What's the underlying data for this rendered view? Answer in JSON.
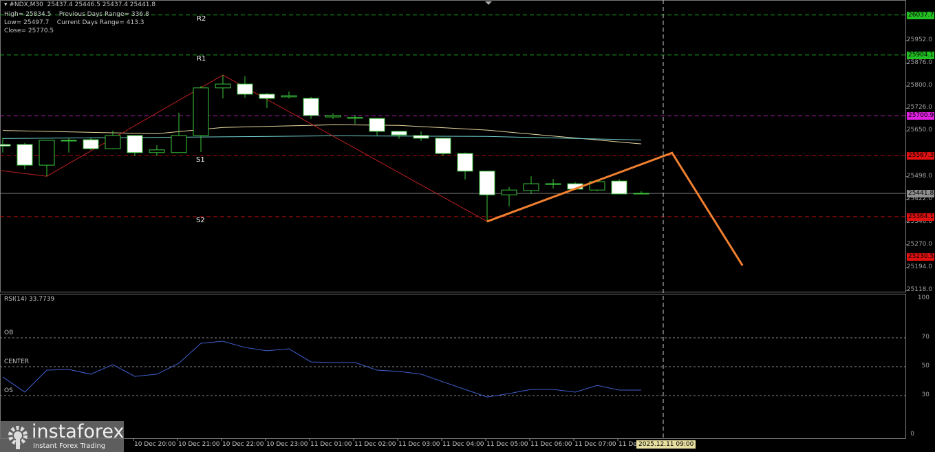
{
  "header": {
    "symbol_line": "#NDX,M30  25437.4 25446.5 25437.4 25441.8",
    "high": "High= 25834.5",
    "prev_range": "Previous Days Range= 336.8",
    "low": "Low= 25497.7",
    "cur_range": "Current Days Range= 413.3",
    "close": "Close= 25770.5"
  },
  "levels": [
    {
      "name": "R2",
      "price": 26037.7,
      "tag": "26037.7",
      "color": "#22c022"
    },
    {
      "name": "R1",
      "price": 25904.1,
      "tag": "25904.1",
      "color": "#22c022"
    },
    {
      "name": "P",
      "price": 25700.9,
      "tag": "25700.9",
      "color": "#e020e0"
    },
    {
      "name": "S1",
      "price": 25567.3,
      "tag": "25567.3",
      "color": "#e01010"
    },
    {
      "name": "current",
      "price": 25441.8,
      "tag": "25441.8",
      "color": "#909090"
    },
    {
      "name": "S2",
      "price": 25364.1,
      "tag": "25364.1",
      "color": "#e01010"
    },
    {
      "name": "target",
      "price": 25230.5,
      "tag": "25230.5",
      "color": "#e01010"
    }
  ],
  "level_labels": {
    "r2": "R2",
    "r1": "R1",
    "s1": "S1",
    "s2": "S2"
  },
  "price_axis": [
    "25952.0",
    "25876.0",
    "25800.0",
    "25726.0",
    "25650.0",
    "25498.0",
    "25422.0",
    "25346.0",
    "25270.0",
    "25194.0",
    "25118.0"
  ],
  "rsi": {
    "title": "RSI(14) 33.7739",
    "ob": "OB",
    "center": "CENTER",
    "os": "OS",
    "axis": [
      "100",
      "70",
      "50",
      "30",
      "0"
    ],
    "color": "#4060d0"
  },
  "time_axis": [
    "10 Dec 20:00",
    "10 Dec 21:00",
    "10 Dec 22:00",
    "10 Dec 23:00",
    "11 Dec 01:00",
    "11 Dec 02:00",
    "11 Dec 03:00",
    "11 Dec 04:00",
    "11 Dec 05:00",
    "11 Dec 06:00",
    "11 Dec 07:00",
    "11 De"
  ],
  "cursor_time": "2025.12.11 09:00",
  "logo": {
    "name": "instaforex",
    "tagline": "Instant Forex Trading"
  },
  "chart_data": {
    "type": "candlestick",
    "symbol": "#NDX",
    "timeframe": "M30",
    "ylim": [
      25100,
      26070
    ],
    "candles_ohlc": [
      [
        25605,
        25628,
        25578,
        25600
      ],
      [
        25605,
        25610,
        25522,
        25536
      ],
      [
        25536,
        25619,
        25499,
        25619
      ],
      [
        25619,
        25628,
        25578,
        25617
      ],
      [
        25621,
        25626,
        25587,
        25591
      ],
      [
        25591,
        25651,
        25589,
        25635
      ],
      [
        25635,
        25635,
        25566,
        25578
      ],
      [
        25578,
        25603,
        25566,
        25587
      ],
      [
        25578,
        25711,
        25578,
        25635
      ],
      [
        25635,
        25800,
        25580,
        25794
      ],
      [
        25794,
        25837,
        25759,
        25807
      ],
      [
        25807,
        25833,
        25761,
        25773
      ],
      [
        25773,
        25777,
        25727,
        25759
      ],
      [
        25764,
        25782,
        25759,
        25768
      ],
      [
        25759,
        25764,
        25690,
        25702
      ],
      [
        25697,
        25709,
        25690,
        25702
      ],
      [
        25695,
        25704,
        25674,
        25695
      ],
      [
        25692,
        25692,
        25635,
        25649
      ],
      [
        25649,
        25649,
        25624,
        25637
      ],
      [
        25635,
        25649,
        25617,
        25626
      ],
      [
        25626,
        25626,
        25568,
        25575
      ],
      [
        25575,
        25578,
        25488,
        25516
      ],
      [
        25516,
        25516,
        25346,
        25437
      ],
      [
        25437,
        25463,
        25398,
        25453
      ],
      [
        25451,
        25499,
        25440,
        25474
      ],
      [
        25474,
        25490,
        25458,
        25474
      ],
      [
        25474,
        25479,
        25470,
        25456
      ],
      [
        25453,
        25474,
        25449,
        25481
      ],
      [
        25483,
        25490,
        25440,
        25440
      ],
      [
        25440,
        25449,
        25440,
        25442
      ]
    ],
    "ma_slow": [
      [
        0,
        25652
      ],
      [
        7,
        25641
      ],
      [
        10,
        25662
      ],
      [
        15,
        25671
      ],
      [
        18,
        25669
      ],
      [
        22,
        25653
      ],
      [
        29,
        25607
      ]
    ],
    "ma_fast": [
      [
        0,
        25625
      ],
      [
        9,
        25630
      ],
      [
        15,
        25634
      ],
      [
        22,
        25632
      ],
      [
        29,
        25620
      ]
    ],
    "zigzag": [
      [
        -0.1,
        25518
      ],
      [
        2,
        25499
      ],
      [
        10,
        25837
      ],
      [
        22,
        25348
      ]
    ],
    "forecast": [
      [
        22,
        25348
      ],
      [
        30.4,
        25577
      ],
      [
        33.6,
        25201
      ]
    ],
    "rsi_values": [
      42.9,
      32.4,
      47.6,
      48.1,
      44.8,
      51.4,
      43.3,
      44.8,
      52.4,
      66.2,
      67.6,
      63.3,
      61,
      62.4,
      53.3,
      52.9,
      52.9,
      47.6,
      46.7,
      44.8,
      39.5,
      34.3,
      29,
      31.4,
      34.3,
      34.3,
      32.4,
      37.1,
      33.8,
      33.8
    ],
    "rsi_levels": [
      70,
      50,
      30
    ]
  }
}
